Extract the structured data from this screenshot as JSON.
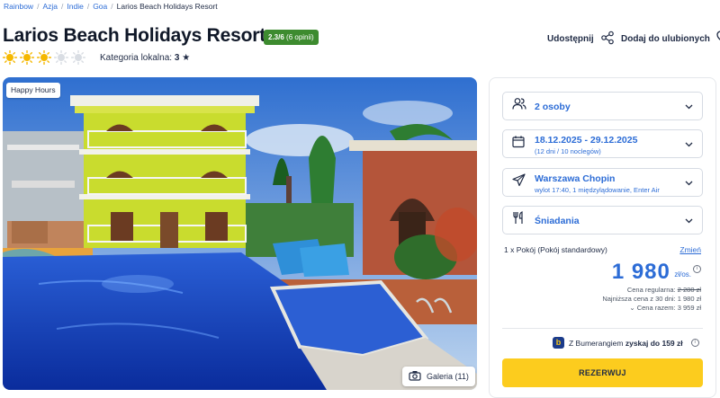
{
  "breadcrumb": [
    "Rainbow",
    "Azja",
    "Indie",
    "Goa",
    "Larios Beach Holidays Resort"
  ],
  "hotel": {
    "name": "Larios Beach Holidays Resort",
    "rating": "2.3/6",
    "rating_count": "(6 opinii)",
    "suns_total": 5,
    "suns_filled": 3,
    "local_category_label": "Kategoria lokalna:",
    "local_category_value": "3"
  },
  "actions": {
    "share": "Udostępnij",
    "favorite": "Dodaj do ulubionych"
  },
  "photo": {
    "badge": "Happy Hours",
    "gallery": "Galeria (11)"
  },
  "booking": {
    "persons": "2 osoby",
    "dates": "18.12.2025 - 29.12.2025",
    "dates_sub": "(12 dni / 10 noclegów)",
    "flight": "Warszawa Chopin",
    "flight_sub": "wylot 17:40, 1 międzylądowanie, Enter Air",
    "board": "Śniadania",
    "room": "1 x Pokój  (Pokój standardowy)",
    "change": "Zmień",
    "price": "1 980",
    "price_unit": "zł/os.",
    "regular_label": "Cena regularna:",
    "regular_value": "2 280 zł",
    "lowest30": "Najniższa cena z 30 dni: 1 980 zł",
    "total": "Cena razem: 3 959 zł",
    "bumerang_pre": "Z Bumerangiem",
    "bumerang_bold": "zyskaj do 159 zł",
    "reserve": "REZERWUJ"
  },
  "colors": {
    "accent": "#2c6cd6",
    "rating_bg": "#3d8b2f",
    "cta": "#fccc1e",
    "sun": "#f5b800",
    "sun_empty": "#d9dde3"
  }
}
